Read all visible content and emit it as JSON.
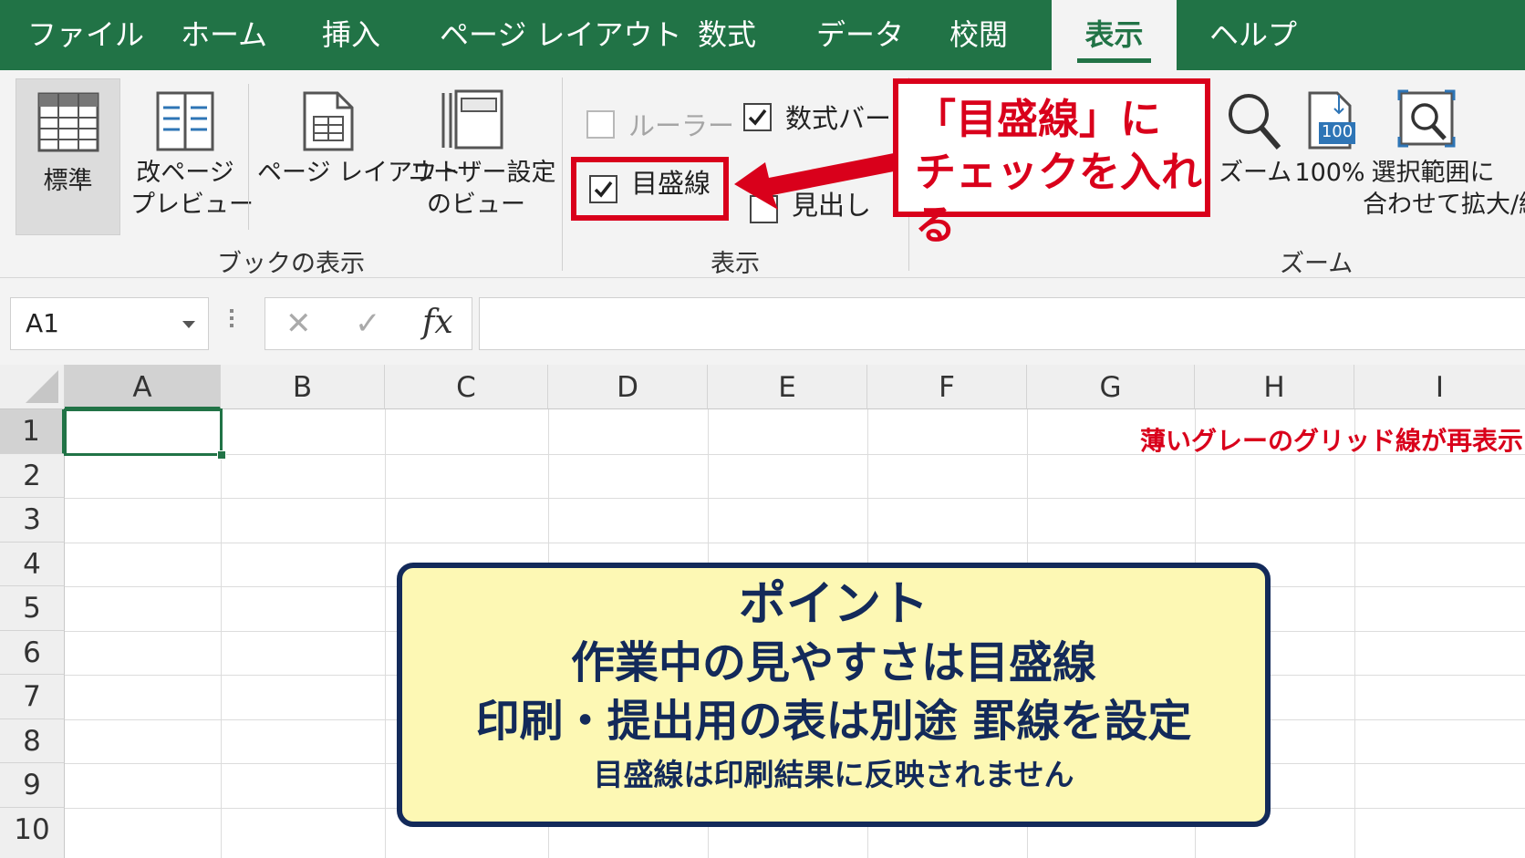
{
  "tabs": [
    {
      "label": "ファイル"
    },
    {
      "label": "ホーム"
    },
    {
      "label": "挿入"
    },
    {
      "label": "ページ レイアウト"
    },
    {
      "label": "数式"
    },
    {
      "label": "データ"
    },
    {
      "label": "校閲"
    },
    {
      "label": "表示",
      "active": true
    },
    {
      "label": "ヘルプ"
    }
  ],
  "ribbon": {
    "workbook_views": {
      "group_label": "ブックの表示",
      "normal": "標準",
      "page_break_line1": "改ページ",
      "page_break_line2": "プレビュー",
      "page_layout": "ページ レイアウト",
      "custom_line1": "ユーザー設定",
      "custom_line2": "のビュー"
    },
    "show": {
      "group_label": "表示",
      "ruler": {
        "label": "ルーラー",
        "checked": false,
        "disabled": true
      },
      "formula_bar": {
        "label": "数式バー",
        "checked": true
      },
      "gridlines": {
        "label": "目盛線",
        "checked": true
      },
      "headings": {
        "label": "見出し",
        "checked": false
      }
    },
    "zoom": {
      "group_label": "ズーム",
      "zoom": "ズーム",
      "hundred": "100%",
      "hundred_icon": "100",
      "fit_line1": "選択範囲に",
      "fit_line2": "合わせて拡大/縮小"
    }
  },
  "callout": {
    "line1": "「目盛線」に",
    "line2": "チェックを入れる"
  },
  "formula_bar": {
    "name_box": "A1",
    "fx": "fx",
    "cancel": "✕",
    "enter": "✓"
  },
  "columns": [
    "A",
    "B",
    "C",
    "D",
    "E",
    "F",
    "G",
    "H",
    "I"
  ],
  "rows": [
    "1",
    "2",
    "3",
    "4",
    "5",
    "6",
    "7",
    "8",
    "9",
    "10"
  ],
  "active_cell": "A1",
  "sheet_note": "薄いグレーのグリッド線が再表示",
  "point_box": {
    "title": "ポイント",
    "line1": "作業中の見やすさは目盛線",
    "line2": "印刷・提出用の表は別途 罫線を設定",
    "line3": "目盛線は印刷結果に反映されません"
  },
  "colors": {
    "excel_green": "#217346",
    "callout_red": "#d9001b",
    "point_navy": "#132a5a",
    "point_bg": "#fdf8b4"
  }
}
